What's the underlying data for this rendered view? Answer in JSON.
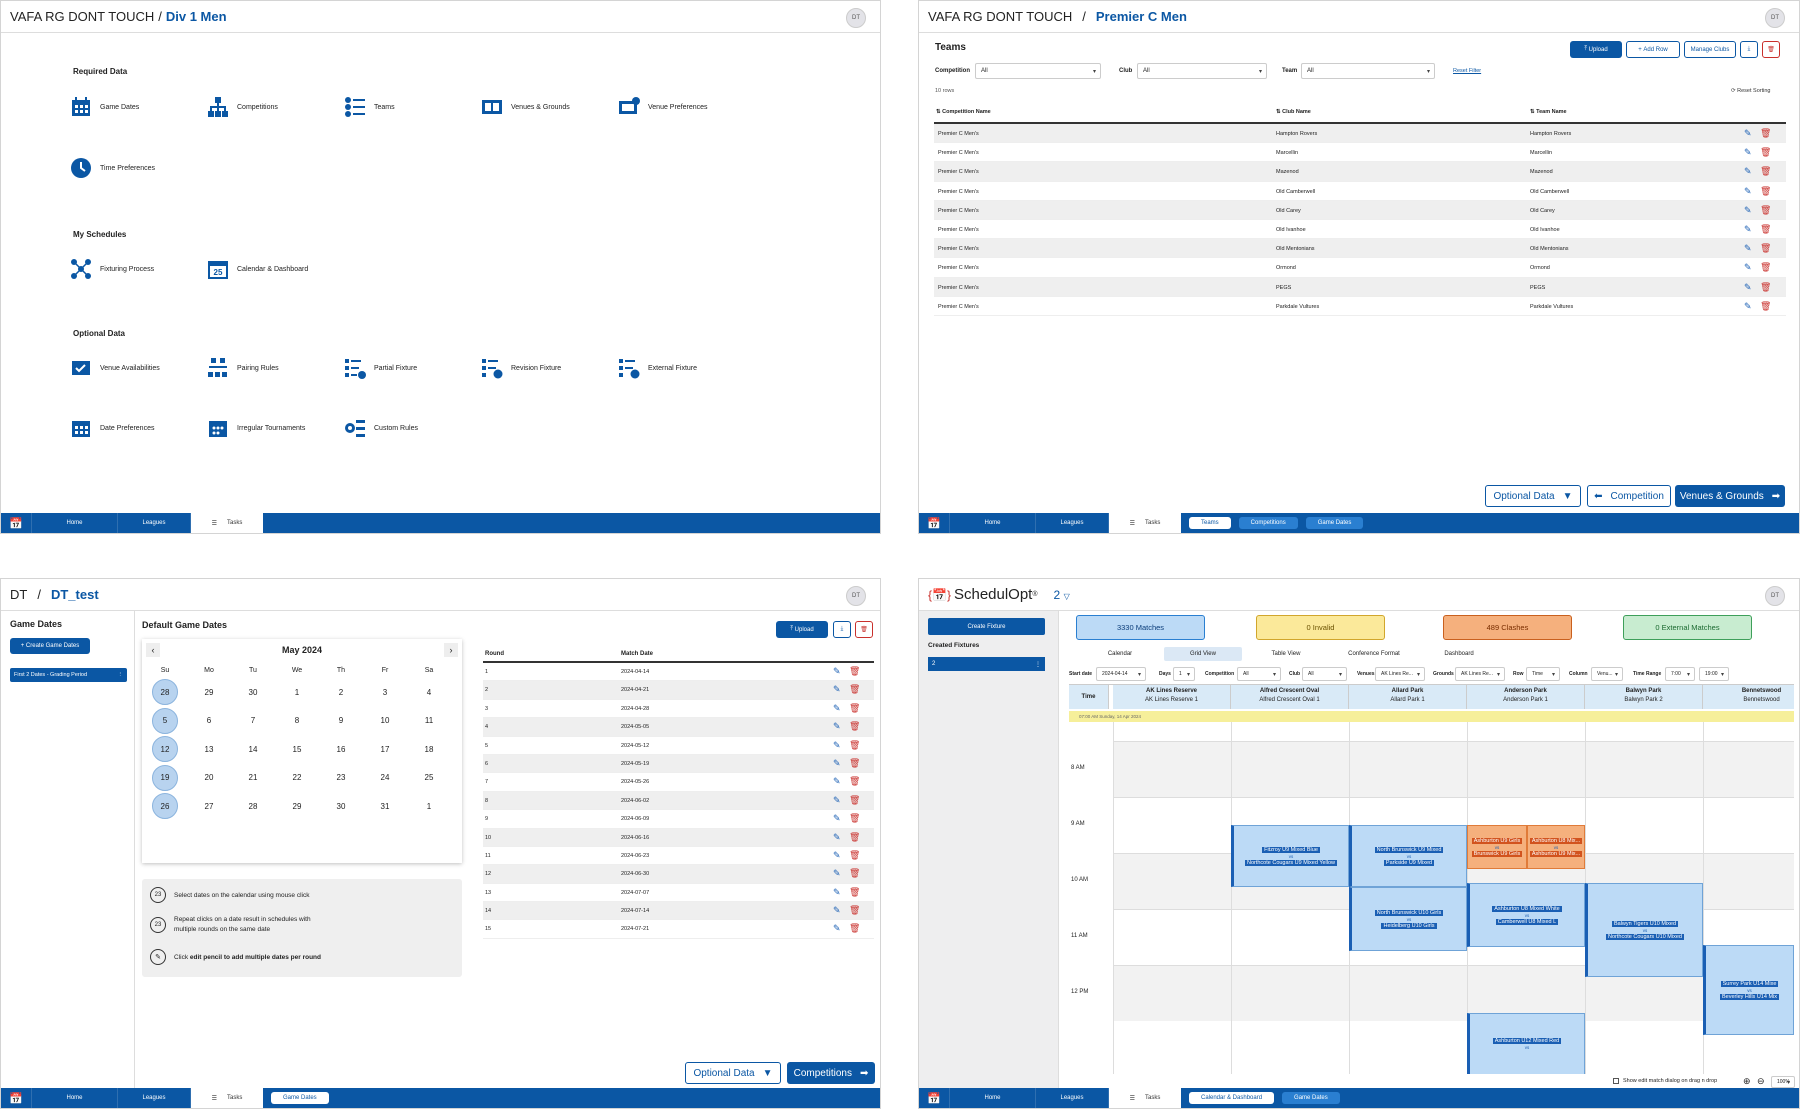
{
  "p1": {
    "title": "VAFA RG DONT TOUCH",
    "subtitle": "Div 1 Men",
    "avatar": "DT",
    "required_heading": "Required Data",
    "required": [
      {
        "label": "Game Dates",
        "icon": "calendar-grid-icon"
      },
      {
        "label": "Competitions",
        "icon": "hierarchy-icon"
      },
      {
        "label": "Teams",
        "icon": "team-list-icon"
      },
      {
        "label": "Venues & Grounds",
        "icon": "venue-icon"
      },
      {
        "label": "Venue Preferences",
        "icon": "venue-pref-icon"
      },
      {
        "label": "Time Preferences",
        "icon": "clock-icon"
      }
    ],
    "schedules_heading": "My Schedules",
    "schedules": [
      {
        "label": "Fixturing Process",
        "icon": "process-icon"
      },
      {
        "label": "Calendar & Dashboard",
        "icon": "calendar-25-icon"
      }
    ],
    "optional_heading": "Optional Data",
    "optional": [
      {
        "label": "Venue Availabilities",
        "icon": "venue-check-icon"
      },
      {
        "label": "Pairing Rules",
        "icon": "pairing-icon"
      },
      {
        "label": "Partial Fixture",
        "icon": "partial-fixture-icon"
      },
      {
        "label": "Revision Fixture",
        "icon": "revision-fixture-icon"
      },
      {
        "label": "External Fixture",
        "icon": "external-fixture-icon"
      },
      {
        "label": "Date Preferences",
        "icon": "calendar-grid-icon"
      },
      {
        "label": "Irregular Tournaments",
        "icon": "calendar-dots-icon"
      },
      {
        "label": "Custom Rules",
        "icon": "gears-icon"
      }
    ],
    "nav": {
      "home": "Home",
      "leagues": "Leagues",
      "tasks": "Tasks"
    }
  },
  "p2": {
    "title": "VAFA RG DONT TOUCH",
    "subtitle": "Premier C Men",
    "avatar": "DT",
    "heading": "Teams",
    "upload": "Upload",
    "add_row": "Add Row",
    "manage_clubs": "Manage Clubs",
    "filters": {
      "competition_label": "Competition",
      "competition_value": "All",
      "club_label": "Club",
      "club_value": "All",
      "team_label": "Team",
      "team_value": "All",
      "reset_filter": "Reset Filter"
    },
    "rows_count": "10 rows",
    "reset_sorting": "Reset Sorting",
    "columns": [
      "Competition Name",
      "Club Name",
      "Team Name"
    ],
    "rows": [
      [
        "Premier C Men's",
        "Hampton Rovers",
        "Hampton Rovers"
      ],
      [
        "Premier C Men's",
        "Marcellin",
        "Marcellin"
      ],
      [
        "Premier C Men's",
        "Mazenod",
        "Mazenod"
      ],
      [
        "Premier C Men's",
        "Old Camberwell",
        "Old Camberwell"
      ],
      [
        "Premier C Men's",
        "Old Carey",
        "Old Carey"
      ],
      [
        "Premier C Men's",
        "Old Ivanhoe",
        "Old Ivanhoe"
      ],
      [
        "Premier C Men's",
        "Old Mentonians",
        "Old Mentonians"
      ],
      [
        "Premier C Men's",
        "Ormond",
        "Ormond"
      ],
      [
        "Premier C Men's",
        "PEGS",
        "PEGS"
      ],
      [
        "Premier C Men's",
        "Parkdale Vultures",
        "Parkdale Vultures"
      ]
    ],
    "optional_data": "Optional Data",
    "back": "Competition",
    "next": "Venues & Grounds",
    "nav": {
      "home": "Home",
      "leagues": "Leagues",
      "tasks": "Tasks",
      "chip1": "Teams",
      "chip2": "Competitions",
      "chip3": "Game Dates"
    }
  },
  "p3": {
    "title": "DT",
    "subtitle": "DT_test",
    "avatar": "DT",
    "side_heading": "Game Dates",
    "create": "+ Create Game Dates",
    "item": "First 2 Dates - Grading Period",
    "main_heading": "Default Game Dates",
    "month": "May 2024",
    "weekdays": [
      "Su",
      "Mo",
      "Tu",
      "We",
      "Th",
      "Fr",
      "Sa"
    ],
    "weeks": [
      [
        "28",
        "29",
        "30",
        "1",
        "2",
        "3",
        "4"
      ],
      [
        "5",
        "6",
        "7",
        "8",
        "9",
        "10",
        "11"
      ],
      [
        "12",
        "13",
        "14",
        "15",
        "16",
        "17",
        "18"
      ],
      [
        "19",
        "20",
        "21",
        "22",
        "23",
        "24",
        "25"
      ],
      [
        "26",
        "27",
        "28",
        "29",
        "30",
        "31",
        "1"
      ]
    ],
    "tip1": "Select dates on the calendar using mouse click",
    "tip2a": "Repeat clicks on a date result in schedules with",
    "tip2b": "multiple rounds on the same date",
    "tip3a": "Click ",
    "tip3b": "edit pencil to add multiple dates per round",
    "upload": "Upload",
    "col_round": "Round",
    "col_date": "Match Date",
    "rows": [
      [
        "1",
        "2024-04-14"
      ],
      [
        "2",
        "2024-04-21"
      ],
      [
        "3",
        "2024-04-28"
      ],
      [
        "4",
        "2024-05-05"
      ],
      [
        "5",
        "2024-05-12"
      ],
      [
        "6",
        "2024-05-19"
      ],
      [
        "7",
        "2024-05-26"
      ],
      [
        "8",
        "2024-06-02"
      ],
      [
        "9",
        "2024-06-09"
      ],
      [
        "10",
        "2024-06-16"
      ],
      [
        "11",
        "2024-06-23"
      ],
      [
        "12",
        "2024-06-30"
      ],
      [
        "13",
        "2024-07-07"
      ],
      [
        "14",
        "2024-07-14"
      ],
      [
        "15",
        "2024-07-21"
      ]
    ],
    "optional_data": "Optional Data",
    "next": "Competitions",
    "nav": {
      "home": "Home",
      "leagues": "Leagues",
      "tasks": "Tasks",
      "chip1": "Game Dates"
    }
  },
  "p4": {
    "brand": "SchedulOpt",
    "reg": "®",
    "fixture": "2",
    "avatar": "DT",
    "create": "Create Fixture",
    "created_heading": "Created Fixtures",
    "created_item": "2",
    "stats": [
      "3330 Matches",
      "0 Invalid",
      "489 Clashes",
      "0 External Matches"
    ],
    "tabs": [
      "Calendar",
      "Grid View",
      "Table View",
      "Conference Format",
      "Dashboard"
    ],
    "filters": {
      "start_label": "Start date",
      "start_value": "2024-04-14",
      "days_label": "Days",
      "days_value": "1",
      "competition_label": "Competition",
      "competition_value": "All",
      "club_label": "Club",
      "club_value": "All",
      "venues_label": "Venues",
      "venues_value": "AK Lines Re...",
      "grounds_label": "Grounds",
      "grounds_value": "AK Lines Re...",
      "row_label": "Row",
      "row_value": "Time",
      "column_label": "Column",
      "column_value": "Venu...",
      "range_label": "Time Range",
      "range_from": "7:00",
      "range_to": "19:00"
    },
    "time_header": "Time",
    "venues": [
      [
        "AK Lines Reserve",
        "AK Lines Reserve 1"
      ],
      [
        "Alfred Crescent Oval",
        "Alfred Crescent Oval 1"
      ],
      [
        "Allard Park",
        "Allard Park 1"
      ],
      [
        "Anderson Park",
        "Anderson Park 1"
      ],
      [
        "Balwyn Park",
        "Balwyn Park 2"
      ],
      [
        "Bennetswood",
        "Bennetswood"
      ]
    ],
    "day_banner": "07:00 AM Sunday, 14 Apr 2024",
    "times": [
      "8 AM",
      "9 AM",
      "10 AM",
      "11 AM",
      "12 PM"
    ],
    "vs": "vs",
    "events": {
      "e1": [
        "Fitzroy U9 Mixed Blue",
        "Northcote Cougars U9 Mixed Yellow"
      ],
      "e2": [
        "North Brunswick U9 Mixed",
        "Parkside U9 Mixed"
      ],
      "e3": [
        "Ashburton U9 Girls",
        "Brunswick U9 Girls"
      ],
      "e4": [
        "Ashburton U8 Mix...",
        "Ashburton U9 Mix..."
      ],
      "e5": [
        "North Brunswick U10 Girls",
        "Heidelberg U10 Girls"
      ],
      "e6": [
        "Ashburton U8 Mixed White",
        "Camberwell U8 Mixed L"
      ],
      "e7": [
        "Balwyn Tigers U10 Mixed",
        "Northcote Cougars U10 Mixed"
      ],
      "e8": [
        "Surrey Park U14 Mixe",
        "Beverley Hills U14 Mix"
      ],
      "e9": [
        "Ashburton U12 Mixed Red"
      ]
    },
    "drag_label": "Show edit match dialog on drag n drop",
    "zoom": "100%",
    "nav": {
      "home": "Home",
      "leagues": "Leagues",
      "tasks": "Tasks",
      "chip1": "Calendar & Dashboard",
      "chip2": "Game Dates"
    },
    "colors": {
      "blue": "#0b57a4",
      "matches": "#bcdaf6",
      "invalid": "#fbe99a",
      "clashes": "#f5b07d",
      "external": "#c8ecd0"
    }
  }
}
